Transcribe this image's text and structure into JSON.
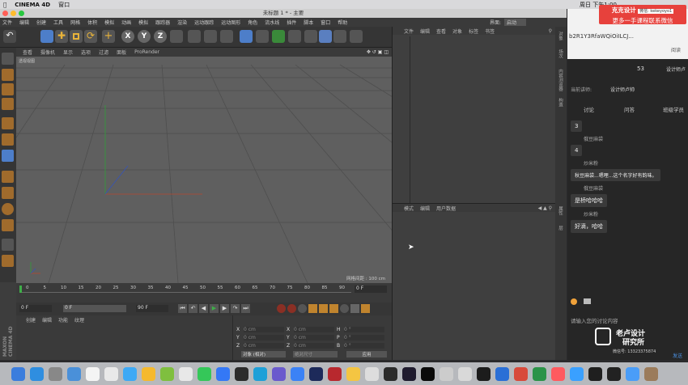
{
  "menubar": {
    "app": "CINEMA 4D",
    "window_menu": "窗口",
    "clock": "周日 下午1:00"
  },
  "c4d": {
    "title": "未标题 1 * - 主要",
    "menus": [
      "文件",
      "编辑",
      "创建",
      "工具",
      "网格",
      "体积",
      "模拟",
      "动画",
      "模拟",
      "跟踪器",
      "渲染",
      "运动跟踪",
      "运动图形",
      "角色",
      "流水线",
      "插件",
      "脚本",
      "窗口",
      "帮助"
    ],
    "interface_label": "界面:",
    "interface_value": "启动",
    "toolbar_xyz": [
      "X",
      "Y",
      "Z"
    ],
    "viewport": {
      "menus": [
        "查看",
        "摄像机",
        "显示",
        "选项",
        "过滤",
        "面板",
        "ProRender"
      ],
      "camera_label": "透视视图",
      "grid_spacing": "网格间距 : 100 cm"
    },
    "timeline": {
      "ticks": [
        "0",
        "5",
        "10",
        "15",
        "20",
        "25",
        "30",
        "35",
        "40",
        "45",
        "50",
        "55",
        "60",
        "65",
        "70",
        "75",
        "80",
        "85",
        "90"
      ],
      "current_frame": "0 F",
      "start": "0 F",
      "end": "90 F",
      "end2": "90 F"
    },
    "materials": {
      "menus": [
        "创建",
        "编辑",
        "功能",
        "纹理"
      ]
    },
    "coords": {
      "rows": [
        {
          "a": "X",
          "v1": "0 cm",
          "b": "X",
          "v2": "0 cm",
          "c": "H",
          "v3": "0 °"
        },
        {
          "a": "Y",
          "v1": "0 cm",
          "b": "Y",
          "v2": "0 cm",
          "c": "P",
          "v3": "0 °"
        },
        {
          "a": "Z",
          "v1": "0 cm",
          "b": "Z",
          "v2": "0 cm",
          "c": "B",
          "v3": "0 °"
        }
      ],
      "dropdown1": "对象 (相对)",
      "dropdown2": "绝对尺寸",
      "apply": "应用"
    },
    "object_manager": {
      "menus": [
        "文件",
        "编辑",
        "查看",
        "对象",
        "标签",
        "书签"
      ]
    },
    "attribute_manager": {
      "menus": [
        "模式",
        "编辑",
        "用户数据"
      ]
    },
    "side_tabs": [
      "对象",
      "场次",
      "内容浏览器",
      "构造",
      "属性",
      "层"
    ]
  },
  "promo": {
    "line1": "克克设计",
    "handle": "微信: kekeyoyo1",
    "line2": "更多一手课程联系微信"
  },
  "chat": {
    "url_fragment": "b2R1Y3RfaWQiOiILCJ...",
    "bookmark": "阅读",
    "count": "53",
    "host_label": "设计师卢",
    "current_speaker_label": "当前讲师:",
    "current_speaker": "设计师卢帅",
    "tabs": [
      "讨论",
      "问答",
      "班级学员"
    ],
    "messages": [
      {
        "name": "",
        "text": "3"
      },
      {
        "name": "俄豆麻袋",
        "text": "4"
      },
      {
        "name": "炒米粉",
        "text": "秋豆麻袋...嗯哩...这个名字好有韵味。"
      },
      {
        "name": "俄豆麻袋",
        "text": "是桥哈哈哈"
      },
      {
        "name": "炒米粉",
        "text": "好滴，哈哈"
      }
    ],
    "input_placeholder": "请输入您的讨论内容",
    "send": "发送",
    "logo_line1": "老卢设计",
    "logo_line2": "研究所",
    "wechat_label": "微信号: 13323375874"
  },
  "colors": {
    "promo_red": "#e7413c",
    "viewport_gray": "#5f5f5f",
    "c4d_blue_selected": "#4d7ec9",
    "timeline_green": "#3fae49"
  }
}
